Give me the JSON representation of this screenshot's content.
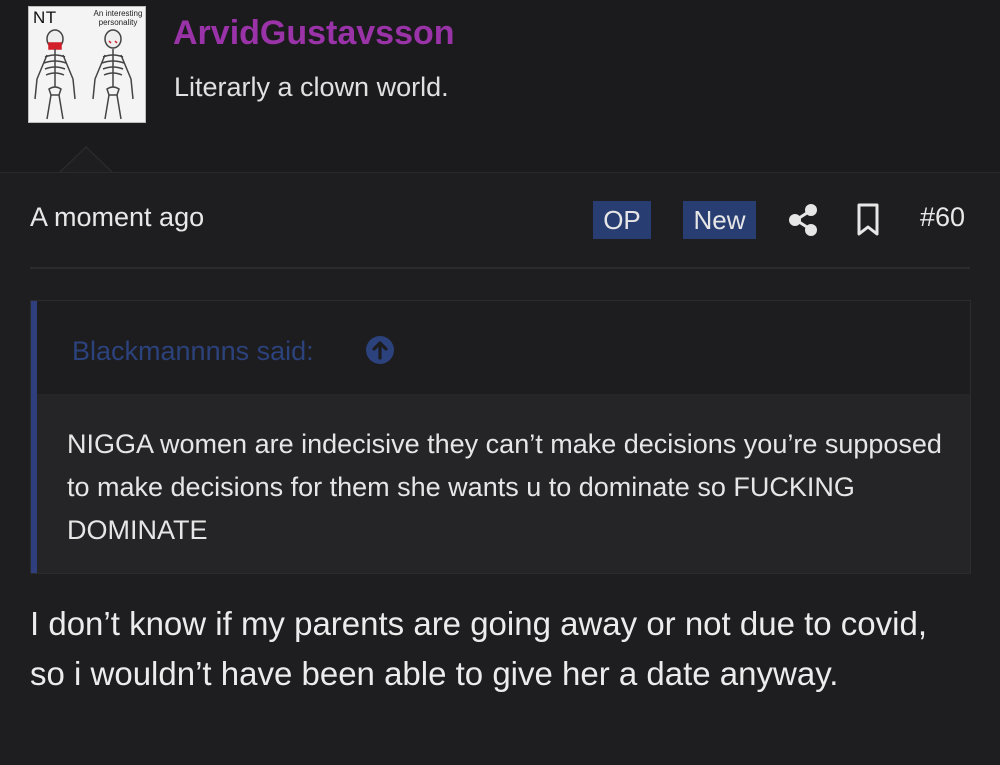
{
  "post": {
    "avatar": {
      "badge_text": "NT",
      "caption": "An interesting personality"
    },
    "username": "ArvidGustavsson",
    "user_title": "Literarly a clown world.",
    "date": "A moment ago",
    "badges": {
      "op": "OP",
      "new": "New"
    },
    "post_number": "#60",
    "quote": {
      "author": "Blackmannnns said:",
      "text": "NIGGA women are indecisive they can’t make decisions you’re supposed to make decisions for them she wants u to dominate so FUCKING DOMINATE"
    },
    "body": "I don’t know if my parents are going away or not due to covid, so i wouldn’t have been able to give her a date anyway."
  },
  "icons": {
    "share": "share-icon",
    "bookmark": "bookmark-icon",
    "quote_jump": "arrow-up-circle-icon"
  },
  "colors": {
    "background": "#1e1e20",
    "username": "#9a33a8",
    "badge": "#283e73",
    "quote_accent": "#2f3f7e"
  }
}
